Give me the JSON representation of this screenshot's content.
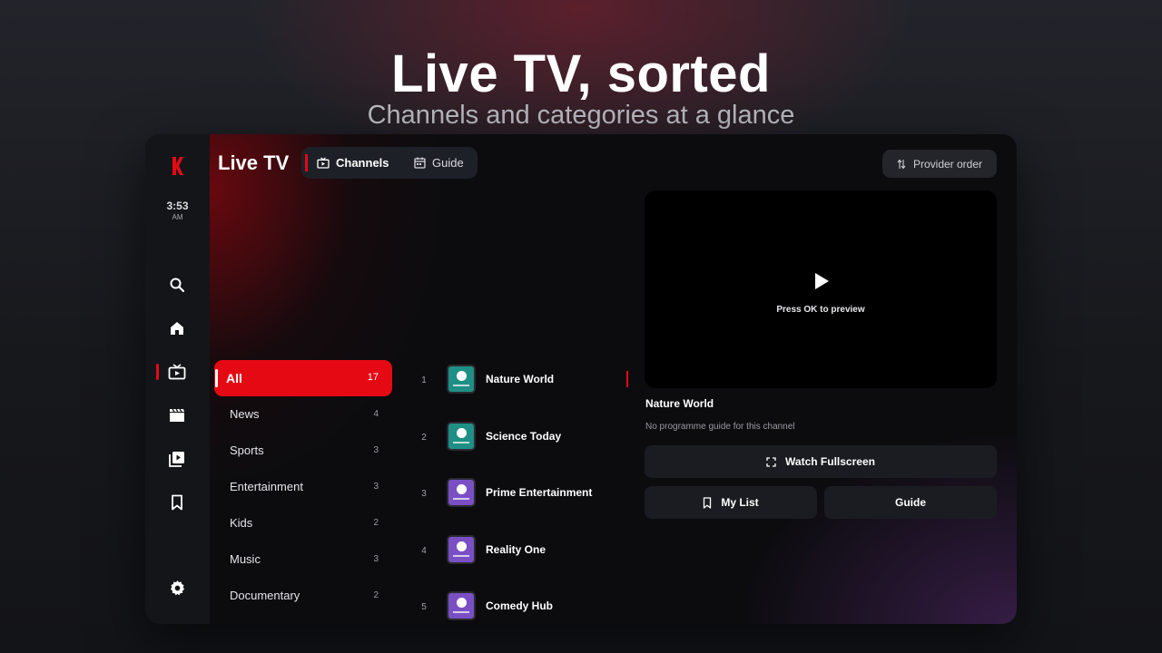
{
  "hero": {
    "title": "Live TV, sorted",
    "subtitle": "Channels and categories at a glance"
  },
  "rail": {
    "logo": "K",
    "clock": {
      "time": "3:53",
      "ampm": "AM"
    },
    "icons": [
      "search-icon",
      "home-icon",
      "live-tv-icon",
      "movies-icon",
      "series-icon",
      "bookmark-icon",
      "settings-icon"
    ],
    "active": "live-tv-icon"
  },
  "header": {
    "title": "Live TV",
    "tabs": [
      {
        "label": "Channels",
        "icon": "tv-icon",
        "active": true
      },
      {
        "label": "Guide",
        "icon": "calendar-icon",
        "active": false
      }
    ],
    "provider_order": "Provider order"
  },
  "categories": [
    {
      "label": "All",
      "count": "17",
      "active": true
    },
    {
      "label": "News",
      "count": "4"
    },
    {
      "label": "Sports",
      "count": "3"
    },
    {
      "label": "Entertainment",
      "count": "3"
    },
    {
      "label": "Kids",
      "count": "2"
    },
    {
      "label": "Music",
      "count": "3"
    },
    {
      "label": "Documentary",
      "count": "2"
    }
  ],
  "channels": [
    {
      "number": "1",
      "name": "Nature World",
      "color": "#1f8f86"
    },
    {
      "number": "2",
      "name": "Science Today",
      "color": "#1f8f86"
    },
    {
      "number": "3",
      "name": "Prime Entertainment",
      "color": "#7b4fc4"
    },
    {
      "number": "4",
      "name": "Reality One",
      "color": "#7b4fc4"
    },
    {
      "number": "5",
      "name": "Comedy Hub",
      "color": "#7b4fc4"
    }
  ],
  "preview": {
    "hint": "Press OK to preview",
    "channel_name": "Nature World",
    "info": "No programme guide for this channel"
  },
  "actions": {
    "watch_fullscreen": "Watch Fullscreen",
    "my_list": "My List",
    "guide": "Guide"
  },
  "colors": {
    "accent": "#e50914"
  }
}
